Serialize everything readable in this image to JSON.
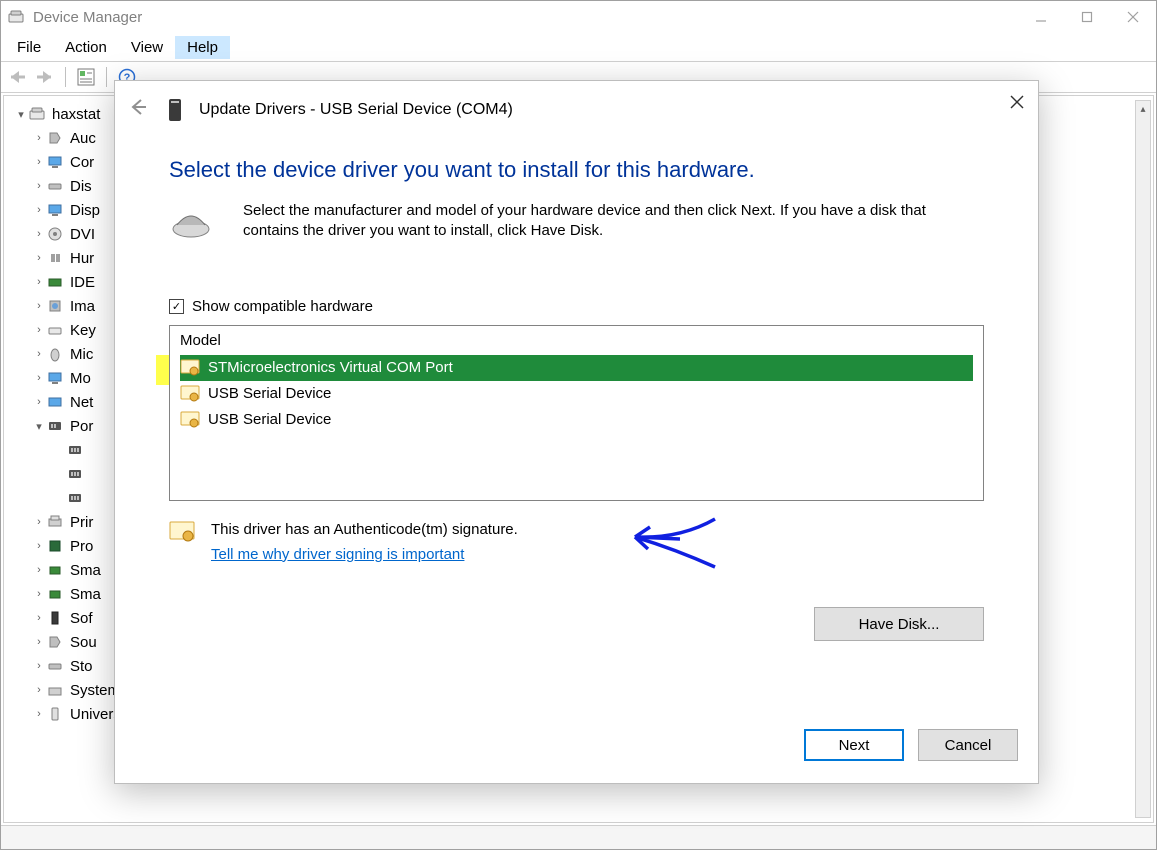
{
  "window": {
    "title": "Device Manager"
  },
  "menu": {
    "file": "File",
    "action": "Action",
    "view": "View",
    "help": "Help"
  },
  "tree": {
    "root": "haxstat",
    "items": [
      "Auc",
      "Cor",
      "Dis",
      "Disp",
      "DVI",
      "Hur",
      "IDE",
      "Ima",
      "Key",
      "Mic",
      "Mo",
      "Net",
      "Por"
    ],
    "sub_blank1": "",
    "sub_blank2": "",
    "sub_blank3": "",
    "items2": [
      "Prir",
      "Pro",
      "Sma",
      "Sma",
      "Sof",
      "Sou",
      "Sto"
    ],
    "system_devices": "System devices",
    "usb_controllers": "Universal Serial Bus controllers"
  },
  "dialog": {
    "title": "Update Drivers - USB Serial Device (COM4)",
    "heading": "Select the device driver you want to install for this hardware.",
    "instructions": "Select the manufacturer and model of your hardware device and then click Next. If you have a disk that contains the driver you want to install, click Have Disk.",
    "show_compatible": "Show compatible hardware",
    "model_header": "Model",
    "models": [
      "STMicroelectronics Virtual COM Port",
      "USB Serial Device",
      "USB Serial Device"
    ],
    "sig_text": "This driver has an Authenticode(tm) signature.",
    "sig_link": "Tell me why driver signing is important",
    "have_disk": "Have Disk...",
    "next": "Next",
    "cancel": "Cancel"
  }
}
